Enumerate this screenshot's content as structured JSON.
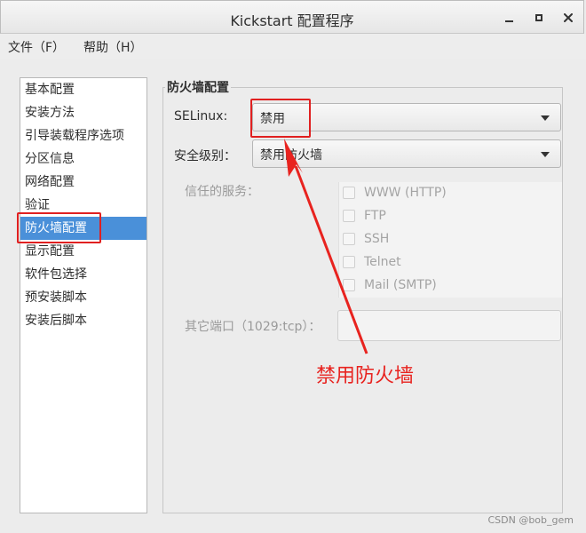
{
  "window": {
    "title": "Kickstart 配置程序",
    "minimize_glyph": "—",
    "maximize_glyph": "□",
    "close_glyph": "✕"
  },
  "menu": {
    "items": [
      {
        "label": "文件（F）"
      },
      {
        "label": "帮助（H）"
      }
    ]
  },
  "sidebar": {
    "items": [
      {
        "label": "基本配置"
      },
      {
        "label": "安装方法"
      },
      {
        "label": "引导装载程序选项"
      },
      {
        "label": "分区信息"
      },
      {
        "label": "网络配置"
      },
      {
        "label": "验证"
      },
      {
        "label": "防火墙配置",
        "selected": true
      },
      {
        "label": "显示配置"
      },
      {
        "label": "软件包选择"
      },
      {
        "label": "预安装脚本"
      },
      {
        "label": "安装后脚本"
      }
    ]
  },
  "firewall": {
    "section_title": "防火墙配置",
    "selinux_label": "SELinux:",
    "selinux_value": "禁用",
    "security_level_label": "安全级别：",
    "security_level_value": "禁用防火墙",
    "trusted_services_label": "信任的服务：",
    "services": [
      {
        "label": "WWW (HTTP)",
        "checked": false
      },
      {
        "label": "FTP",
        "checked": false
      },
      {
        "label": "SSH",
        "checked": false
      },
      {
        "label": "Telnet",
        "checked": false
      },
      {
        "label": "Mail (SMTP)",
        "checked": false
      }
    ],
    "other_ports_label": "其它端口（1029:tcp）：",
    "other_ports_value": ""
  },
  "annotation": {
    "text": "禁用防火墙",
    "color": "#e8231f"
  },
  "watermark": "CSDN @bob_gem",
  "colors": {
    "selection": "#4a90d9",
    "highlight_box": "#e02020"
  }
}
